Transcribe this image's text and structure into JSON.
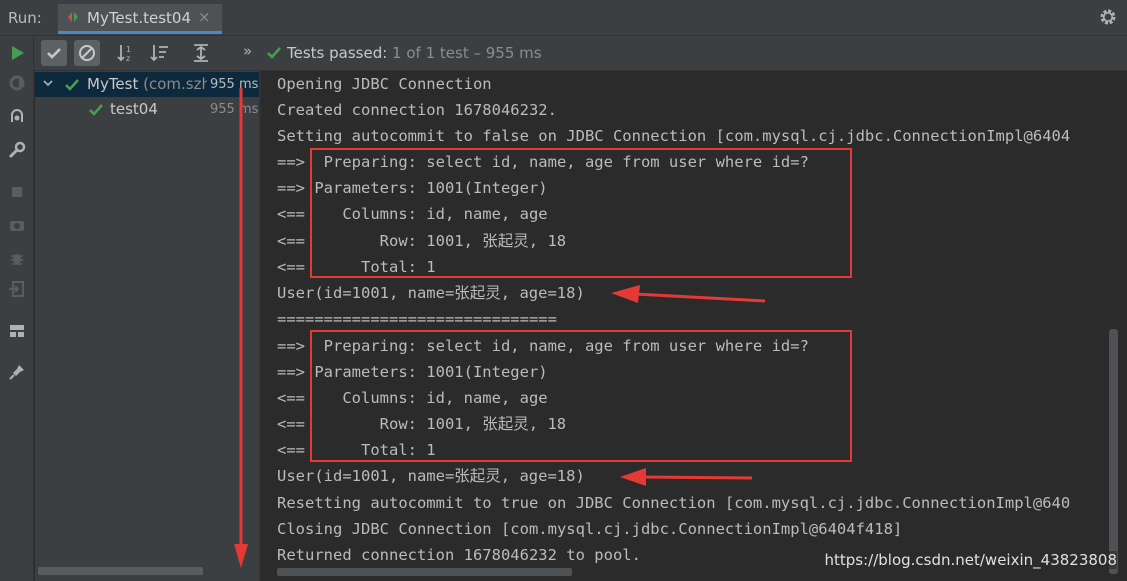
{
  "topbar": {
    "run_label": "Run:",
    "tab_title": "MyTest.test04",
    "tab_close": "×"
  },
  "toolbar": {
    "status_label": "Tests passed: ",
    "status_detail": "1 of 1 test – 955 ms",
    "overflow_label": "»"
  },
  "tree": {
    "suite_name": "MyTest",
    "suite_package": " (com.szh",
    "suite_time": "955 ms",
    "test_name": "test04",
    "test_time": "955 ms"
  },
  "console": {
    "lines": [
      "Opening JDBC Connection",
      "Created connection 1678046232.",
      "Setting autocommit to false on JDBC Connection [com.mysql.cj.jdbc.ConnectionImpl@6404",
      "==>  Preparing: select id, name, age from user where id=?",
      "==> Parameters: 1001(Integer)",
      "<==    Columns: id, name, age",
      "<==        Row: 1001, 张起灵, 18",
      "<==      Total: 1",
      "User(id=1001, name=张起灵, age=18)",
      "==============================",
      "==>  Preparing: select id, name, age from user where id=?",
      "==> Parameters: 1001(Integer)",
      "<==    Columns: id, name, age",
      "<==        Row: 1001, 张起灵, 18",
      "<==      Total: 1",
      "User(id=1001, name=张起灵, age=18)",
      "Resetting autocommit to true on JDBC Connection [com.mysql.cj.jdbc.ConnectionImpl@640",
      "Closing JDBC Connection [com.mysql.cj.jdbc.ConnectionImpl@6404f418]",
      "Returned connection 1678046232 to pool."
    ]
  },
  "icons": {
    "left_toolbar": [
      "run-icon",
      "rerun-failed-icon",
      "debug-icon",
      "wrench-icon",
      "stop-icon",
      "camera-icon",
      "bug-icon",
      "exit-icon",
      "layout-icon",
      "pin-icon"
    ],
    "test_toolbar": [
      "show-passed-icon",
      "show-ignored-icon",
      "sort-alpha-icon",
      "sort-duration-icon",
      "expand-all-icon"
    ]
  },
  "colors": {
    "accent_green": "#499c54",
    "annotation_red": "#e53935",
    "selection_blue": "#0d293e"
  },
  "watermark": "https://blog.csdn.net/weixin_43823808"
}
